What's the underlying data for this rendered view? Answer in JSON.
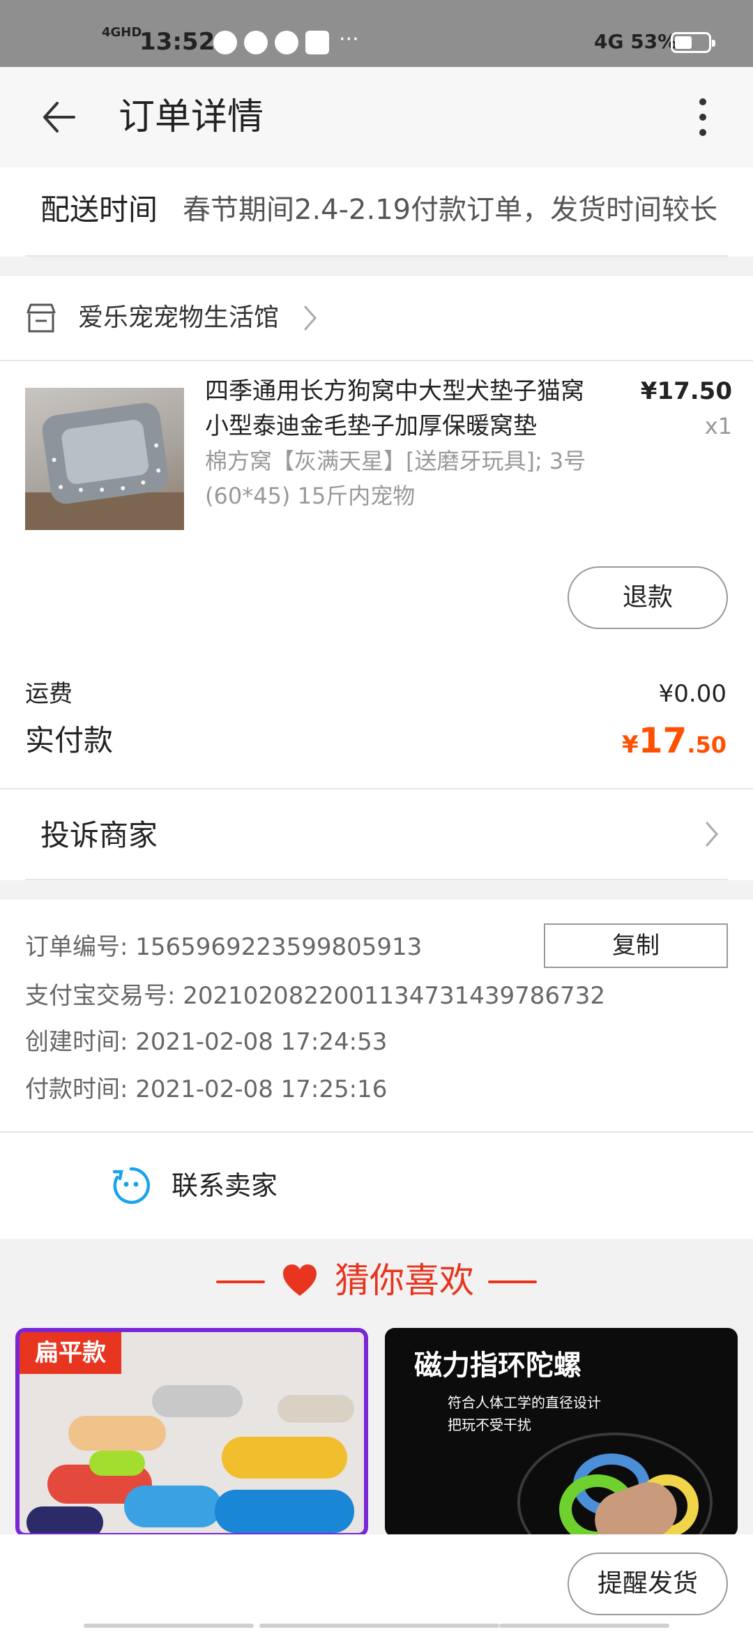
{
  "status_bar": {
    "network": "4GHD",
    "time": "13:52",
    "right_network": "4G",
    "battery": "53%",
    "battery_level": 0.53
  },
  "header": {
    "title": "订单详情"
  },
  "delivery": {
    "label": "配送时间",
    "text": "春节期间2.4-2.19付款订单，发货时间较长"
  },
  "shop": {
    "name": "爱乐宠宠物生活馆"
  },
  "product": {
    "title": "四季通用长方狗窝中大型犬垫子猫窝小型泰迪金毛垫子加厚保暖窝垫",
    "sku": "棉方窝【灰满天星】[送磨牙玩具]; 3号(60*45) 15斤内宠物",
    "price": "¥17.50",
    "quantity": "x1",
    "refund_label": "退款"
  },
  "summary": {
    "shipping_label": "运费",
    "shipping_value": "¥0.00",
    "paid_label": "实付款",
    "paid_symbol": "¥",
    "paid_int": "17",
    "paid_dec": ".50"
  },
  "complain": {
    "label": "投诉商家"
  },
  "order_info": {
    "order_no_label": "订单编号: ",
    "order_no": "1565969223599805913",
    "copy_label": "复制",
    "alipay_label": "支付宝交易号: ",
    "alipay_no": "2021020822001134731439786732",
    "created_label": "创建时间: ",
    "created_time": "2021-02-08 17:24:53",
    "paid_time_label": "付款时间: ",
    "paid_time": "2021-02-08 17:25:16"
  },
  "contact": {
    "label": "联系卖家"
  },
  "guess": {
    "title": "猜你喜欢",
    "items": [
      {
        "tag": "扁平款"
      },
      {
        "title": "磁力指环陀螺",
        "sub1": "符合人体工学的直径设计",
        "sub2": "把玩不受干扰"
      }
    ]
  },
  "bottom": {
    "remind_label": "提醒发货"
  },
  "colors": {
    "accent": "#ff5000",
    "guess_red": "#e8351f",
    "status_bar": "#8f8f8f"
  }
}
